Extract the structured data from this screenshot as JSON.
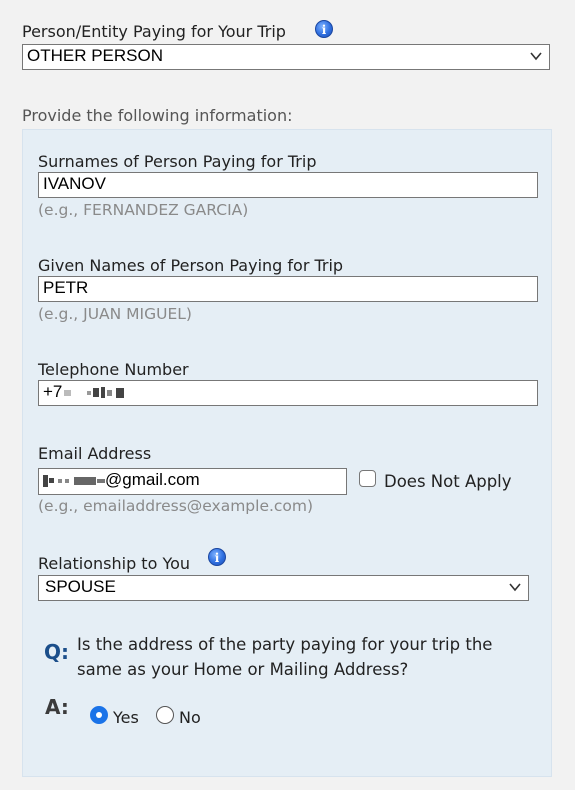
{
  "payer": {
    "label": "Person/Entity Paying for Your Trip",
    "info_icon": "info-icon",
    "selected": "OTHER PERSON"
  },
  "provide_label": "Provide the following information:",
  "surnames": {
    "label": "Surnames of Person Paying for Trip",
    "value": "IVANOV",
    "hint": "(e.g., FERNANDEZ GARCIA)"
  },
  "given_names": {
    "label": "Given Names of Person Paying for Trip",
    "value": "PETR",
    "hint": "(e.g., JUAN MIGUEL)"
  },
  "telephone": {
    "label": "Telephone Number",
    "value_prefix": "+7"
  },
  "email": {
    "label": "Email Address",
    "value_suffix": "@gmail.com",
    "does_not_apply": "Does Not Apply",
    "hint": "(e.g., emailaddress@example.com)"
  },
  "relationship": {
    "label": "Relationship to You",
    "selected": "SPOUSE"
  },
  "question": {
    "q_marker": "Q:",
    "text_line1": "Is the address of the party paying for your trip the",
    "text_line2": "same as your Home or Mailing Address?",
    "a_marker": "A:",
    "yes_label": "Yes",
    "no_label": "No",
    "selected": "Yes"
  }
}
